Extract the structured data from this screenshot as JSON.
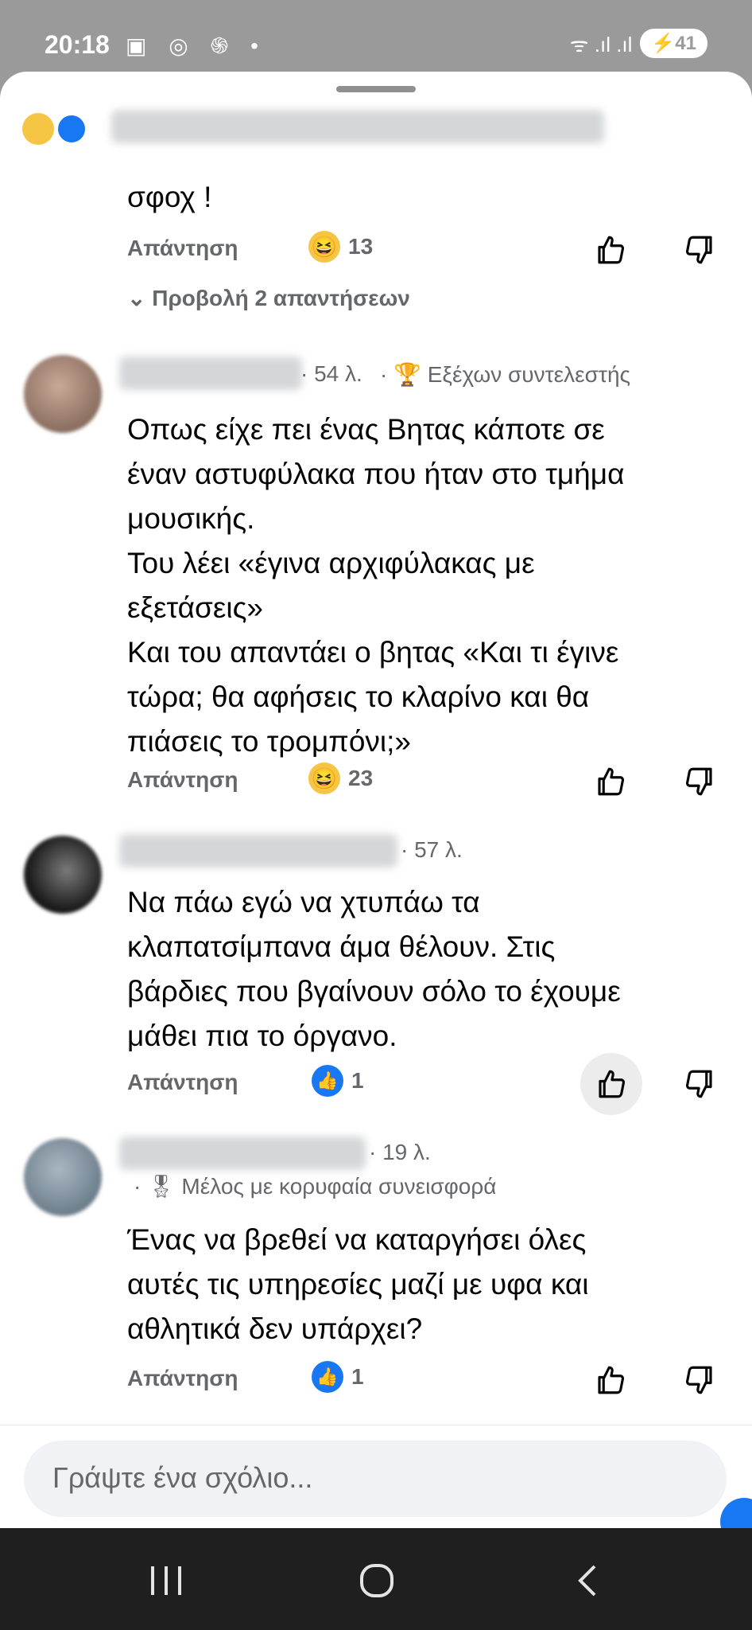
{
  "status": {
    "time": "20:18",
    "left_icons": "▣ ◎ ֍ •",
    "signal": "ᯤ .ıl .ıl",
    "battery": "⚡41"
  },
  "comments": [
    {
      "text": "σφοχ !",
      "reply": "Απάντηση",
      "reaction": "13",
      "reaction_icon": "laugh",
      "view_replies": "Προβολή 2 απαντήσεων"
    },
    {
      "time": "· 54 λ.",
      "badge": "· 🏆 Εξέχων συντελεστής",
      "text": "Οπως είχε πει ένας Βητας κάποτε σε\nέναν αστυφύλακα που ήταν στο τμήμα\nμουσικής.\nΤου λέει «έγινα αρχιφύλακας με\nεξετάσεις»\nΚαι του απαντάει ο βητας «Και τι έγινε\nτώρα; θα αφήσεις το κλαρίνο και θα\nπιάσεις το τρομπόνι;»",
      "reply": "Απάντηση",
      "reaction": "23",
      "reaction_icon": "laugh"
    },
    {
      "time": "· 57 λ.",
      "text": "Να πάω εγώ να χτυπάω τα\nκλαπατσίμπανα άμα θέλουν. Στις\nβάρδιες που βγαίνουν σόλο το έχουμε\nμάθει πια το όργανο.",
      "reply": "Απάντηση",
      "reaction": "1",
      "reaction_icon": "like"
    },
    {
      "time": "· 19 λ.",
      "badge": "· 🎖 Μέλος με κορυφαία συνεισφορά",
      "text": "Ένας να βρεθεί να καταργήσει όλες\nαυτές τις υπηρεσίες μαζί με υφα και\nαθλητικά δεν υπάρχει?",
      "reply": "Απάντηση",
      "reaction": "1",
      "reaction_icon": "like"
    }
  ],
  "composer": {
    "placeholder": "Γράψτε ένα σχόλιο..."
  },
  "colors": {
    "brand_blue": "#1877f2",
    "laugh_yellow": "#f7c544",
    "meta_gray": "#65676b"
  }
}
